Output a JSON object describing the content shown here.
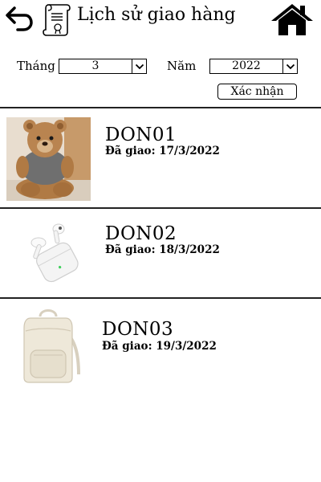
{
  "header": {
    "title": "Lịch sử giao hàng"
  },
  "filter": {
    "month_label": "Tháng",
    "month_value": "3",
    "year_label": "Năm",
    "year_value": "2022",
    "confirm_label": "Xác nhận"
  },
  "orders": [
    {
      "code": "DON01",
      "date": "Đã giao: 17/3/2022",
      "image": "teddy-bear"
    },
    {
      "code": "DON02",
      "date": "Đã giao: 18/3/2022",
      "image": "wireless-earbuds"
    },
    {
      "code": "DON03",
      "date": "Đã giao: 19/3/2022",
      "image": "backpack"
    }
  ]
}
